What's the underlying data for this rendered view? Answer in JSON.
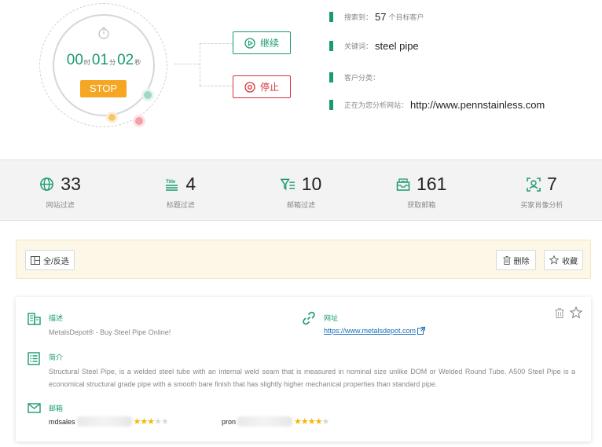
{
  "timer": {
    "hours": "00",
    "hours_unit": "时",
    "minutes": "01",
    "minutes_unit": "分",
    "seconds": "02",
    "seconds_unit": "秒",
    "stop_label": "STOP"
  },
  "actions": {
    "continue_label": "继续",
    "stop_label": "停止"
  },
  "info": {
    "found_label": "搜索到：",
    "found_count": "57",
    "found_suffix": "个目标客户",
    "keyword_label": "关键词：",
    "keyword_value": "steel pipe",
    "category_label": "客户分类：",
    "category_value": "",
    "analyzing_label": "正在为您分析网站：",
    "analyzing_value": "http://www.pennstainless.com"
  },
  "stats": [
    {
      "icon": "globe-icon",
      "value": "33",
      "label": "网站过滤"
    },
    {
      "icon": "title-icon",
      "value": "4",
      "label": "标题过滤"
    },
    {
      "icon": "filter-icon",
      "value": "10",
      "label": "邮箱过滤"
    },
    {
      "icon": "mail-inbox-icon",
      "value": "161",
      "label": "获取邮箱"
    },
    {
      "icon": "user-portrait-icon",
      "value": "7",
      "label": "买家肖像分析"
    }
  ],
  "toolbar": {
    "select_all_label": "全/反选",
    "delete_label": "删除",
    "favorite_label": "收藏"
  },
  "result": {
    "desc_title": "描述",
    "desc_text": "MetalsDepot® - Buy Steel Pipe Online!",
    "url_title": "网址",
    "url_text": "https://www.metalsdepot.com",
    "intro_title": "简介",
    "intro_text": "Structural Steel Pipe, is a welded steel tube with an internal weld seam that is measured in nominal size unlike DOM or Welded Round Tube. A500 Steel Pipe is a economical structural grade pipe with a smooth bare finish that has slightly higher mechanical properties than standard pipe.",
    "email_title": "邮箱",
    "emails": [
      {
        "prefix": "mdsales",
        "rating": 3
      },
      {
        "prefix": "pron",
        "rating": 4
      }
    ]
  },
  "colors": {
    "accent": "#1a9b6c",
    "danger": "#d6333a",
    "warning": "#f5a623",
    "link": "#1a6fb8",
    "star": "#f5b800"
  }
}
